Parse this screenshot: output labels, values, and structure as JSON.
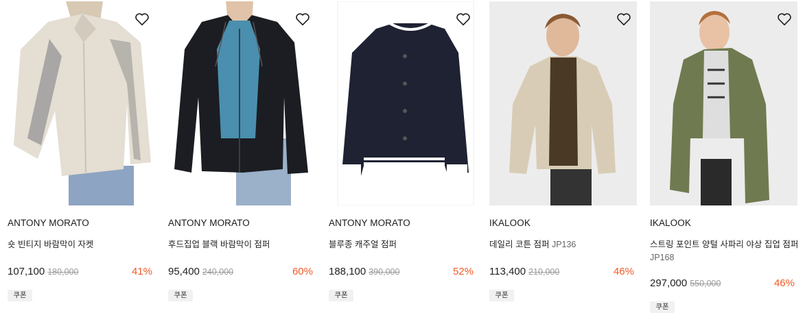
{
  "products": [
    {
      "brand": "ANTONY MORATO",
      "name": "숏 빈티지 바람막이 자켓",
      "code": "",
      "price": "107,100",
      "original_price": "180,000",
      "discount": "41%",
      "coupon": "쿠폰",
      "image_icon": "beige-windbreaker-jacket-photo",
      "jacket_color": "#e4ded3"
    },
    {
      "brand": "ANTONY MORATO",
      "name": "후드집업 블랙 바람막이 점퍼",
      "code": "",
      "price": "95,400",
      "original_price": "240,000",
      "discount": "60%",
      "coupon": "쿠폰",
      "image_icon": "black-hooded-windbreaker-photo",
      "jacket_color": "#1b1d22"
    },
    {
      "brand": "ANTONY MORATO",
      "name": "블루종 캐주얼 점퍼",
      "code": "",
      "price": "188,100",
      "original_price": "390,000",
      "discount": "52%",
      "coupon": "쿠폰",
      "image_icon": "navy-varsity-jacket-photo",
      "jacket_color": "#1e2233"
    },
    {
      "brand": "IKALOOK",
      "name": "데일리 코튼 점퍼",
      "code": "JP136",
      "price": "113,400",
      "original_price": "210,000",
      "discount": "46%",
      "coupon": "쿠폰",
      "image_icon": "beige-cotton-jumper-photo",
      "jacket_color": "#d9ccb6"
    },
    {
      "brand": "IKALOOK",
      "name": "스트링 포인트 양털 사파리 야상 집업 점퍼",
      "code": "JP168",
      "price": "297,000",
      "original_price": "550,000",
      "discount": "46%",
      "coupon": "쿠폰",
      "image_icon": "khaki-safari-parka-photo",
      "jacket_color": "#707a50"
    }
  ],
  "wishlist_icon": "heart-outline-icon",
  "colors": {
    "discount": "#f05a28",
    "strike": "#9a9a9a"
  }
}
